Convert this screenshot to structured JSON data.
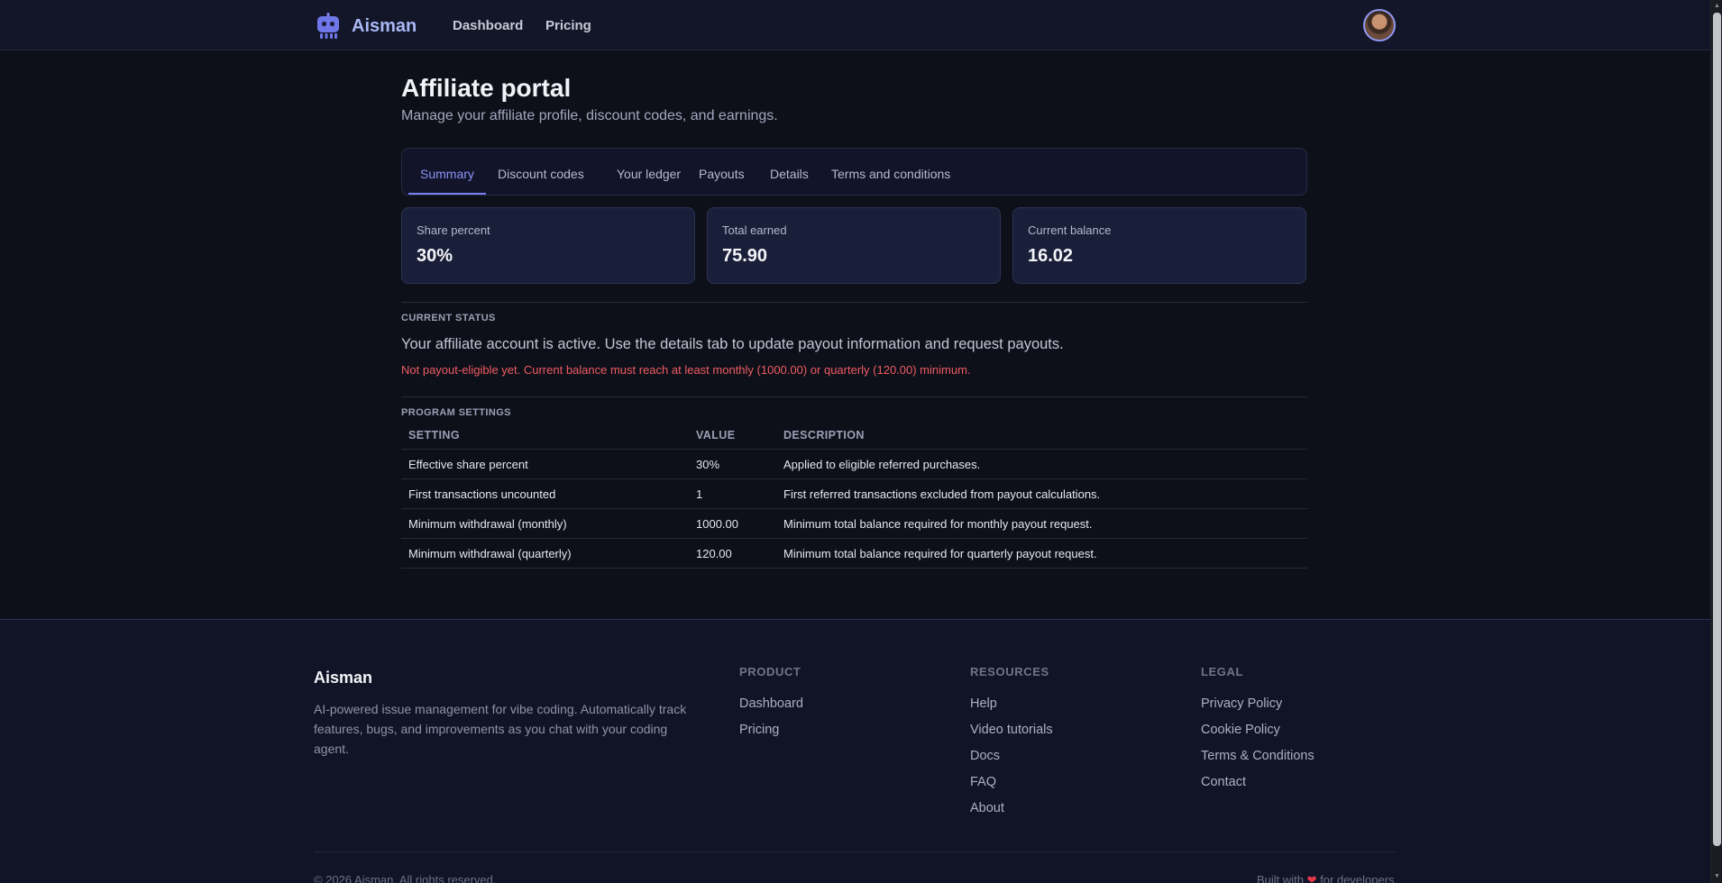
{
  "header": {
    "brand": "Aisman",
    "nav": [
      {
        "label": "Dashboard"
      },
      {
        "label": "Pricing"
      }
    ],
    "icons": {
      "logo": "robot-icon",
      "avatar": "user-avatar"
    }
  },
  "main": {
    "title": "Affiliate portal",
    "subtitle": "Manage your affiliate profile, discount codes, and earnings.",
    "tabs": [
      {
        "label": "Summary",
        "active": true
      },
      {
        "label": "Discount codes"
      },
      {
        "label": "Your ledger"
      },
      {
        "label": "Payouts"
      },
      {
        "label": "Details"
      },
      {
        "label": "Terms and conditions"
      }
    ],
    "stats": [
      {
        "label": "Share percent",
        "value": "30%"
      },
      {
        "label": "Total earned",
        "value": "75.90"
      },
      {
        "label": "Current balance",
        "value": "16.02"
      }
    ],
    "current_status": {
      "label": "CURRENT STATUS",
      "text": "Your affiliate account is active. Use the details tab to update payout information and request payouts.",
      "warning": "Not payout-eligible yet. Current balance must reach at least monthly (1000.00) or quarterly (120.00) minimum."
    },
    "program_settings": {
      "label": "PROGRAM SETTINGS",
      "columns": [
        "SETTING",
        "VALUE",
        "DESCRIPTION"
      ],
      "rows": [
        {
          "setting": "Effective share percent",
          "value": "30%",
          "description": "Applied to eligible referred purchases."
        },
        {
          "setting": "First transactions uncounted",
          "value": "1",
          "description": "First referred transactions excluded from payout calculations."
        },
        {
          "setting": "Minimum withdrawal (monthly)",
          "value": "1000.00",
          "description": "Minimum total balance required for monthly payout request."
        },
        {
          "setting": "Minimum withdrawal (quarterly)",
          "value": "120.00",
          "description": "Minimum total balance required for quarterly payout request."
        }
      ]
    }
  },
  "footer": {
    "brand": "Aisman",
    "description": "AI-powered issue management for vibe coding. Automatically track features, bugs, and improvements as you chat with your coding agent.",
    "columns": [
      {
        "heading": "PRODUCT",
        "links": [
          "Dashboard",
          "Pricing"
        ]
      },
      {
        "heading": "RESOURCES",
        "links": [
          "Help",
          "Video tutorials",
          "Docs",
          "FAQ",
          "About"
        ]
      },
      {
        "heading": "LEGAL",
        "links": [
          "Privacy Policy",
          "Cookie Policy",
          "Terms & Conditions",
          "Contact"
        ]
      }
    ],
    "copyright": "© 2026 Aisman. All rights reserved.",
    "built_prefix": "Built with",
    "built_suffix": "for developers",
    "heart_icon": "heart-icon"
  },
  "colors": {
    "accent": "#7880ef",
    "background": "#0e1019",
    "warning": "#ef5b63"
  }
}
